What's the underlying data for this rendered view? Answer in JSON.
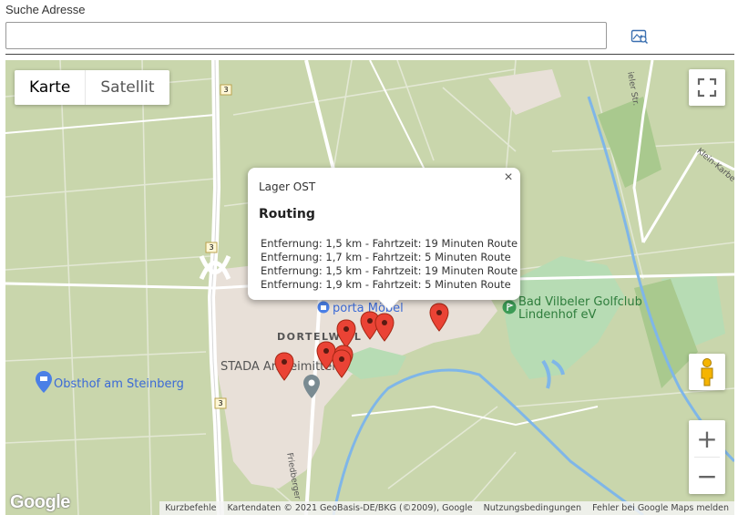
{
  "search": {
    "label": "Suche Adresse",
    "value": "",
    "icon": "map-search-icon"
  },
  "map": {
    "type_buttons": {
      "map": "Karte",
      "satellite": "Satellit",
      "active": "map"
    },
    "labels": {
      "porta": "porta Möbel",
      "dortelweil": "DORTELWEIL",
      "stada": "STADA Arzneimittel",
      "obsthof": "Obsthof am Steinberg",
      "golf": "Bad Vilbeler Golfclub Lindenhof eV",
      "golf_line1": "Bad Vilbeler Golfclub",
      "golf_line2": "Lindenhof eV",
      "route3": "3",
      "road_top": "ieler Str.",
      "road_right": "Klein-Karbe",
      "road_bottom": "Friedberger"
    },
    "infowindow": {
      "title": "Lager OST",
      "heading": "Routing",
      "close": "×",
      "rows": [
        "Entfernung: 1,5 km - Fahrtzeit: 19 Minuten Route",
        "Entfernung: 1,7 km - Fahrtzeit: 5 Minuten Route",
        "Entfernung: 1,5 km - Fahrtzeit: 19 Minuten Route",
        "Entfernung: 1,9 km - Fahrtzeit: 5 Minuten Route"
      ]
    },
    "logo": "Google",
    "attribution": {
      "shortcuts": "Kurzbefehle",
      "data": "Kartendaten © 2021 GeoBasis-DE/BKG (©2009), Google",
      "terms": "Nutzungsbedingungen",
      "report": "Fehler bei Google Maps melden"
    },
    "controls": {
      "fullscreen": "fullscreen-icon",
      "pegman": "pegman-icon",
      "zoom_in": "+",
      "zoom_out": "−"
    },
    "colors": {
      "land": "#c9d6ac",
      "urban": "#e8e0d8",
      "water": "#7fb6e8",
      "marker": "#ea4335",
      "park": "#b7dcb4"
    }
  }
}
